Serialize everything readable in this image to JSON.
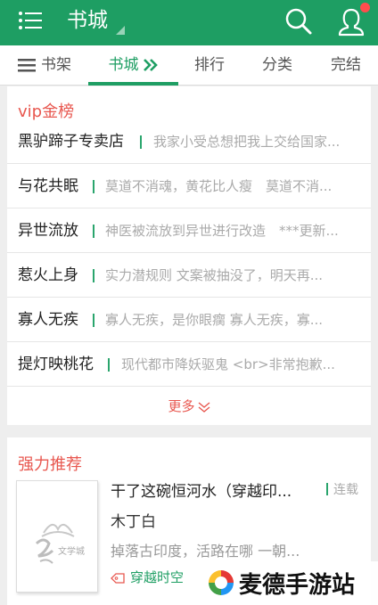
{
  "appbar": {
    "title": "书城",
    "menu_icon": "menu-list-icon",
    "search_icon": "search-icon",
    "user_icon": "user-icon",
    "accent_color": "#1e9e63",
    "notification_dot_color": "#ff4d4d"
  },
  "tabs": [
    {
      "label": "书架",
      "icon": "list-icon"
    },
    {
      "label": "书城",
      "icon": "double-chevron-right-icon",
      "active": true
    },
    {
      "label": "排行"
    },
    {
      "label": "分类"
    },
    {
      "label": "完结"
    }
  ],
  "vip": {
    "title": "vip金榜",
    "rows": [
      {
        "name": "黑驴蹄子专卖店",
        "desc": "我家小受总想把我上交给国家..."
      },
      {
        "name": "与花共眠",
        "desc": "莫道不消魂，黄花比人瘦　莫道不消..."
      },
      {
        "name": "异世流放",
        "desc": "神医被流放到异世进行改造　***更新..."
      },
      {
        "name": "惹火上身",
        "desc": "实力潜规则 文案被抽没了，明天再..."
      },
      {
        "name": "寡人无疾",
        "desc": "寡人无疾，是你眼瘸 寡人无疾，寡..."
      },
      {
        "name": "提灯映桃花",
        "desc": "现代都市降妖驱鬼 <br>非常抱歉..."
      }
    ],
    "more_label": "更多"
  },
  "recommend": {
    "title": "强力推荐",
    "book": {
      "title": "干了这碗恒河水（穿越印...",
      "status": "连载",
      "author": "木丁白",
      "intro": "掉落古印度，活路在哪 一朝...",
      "tag": "穿越时空",
      "cover_text": "文学城"
    }
  },
  "watermark": {
    "text": "麦德手游站"
  }
}
